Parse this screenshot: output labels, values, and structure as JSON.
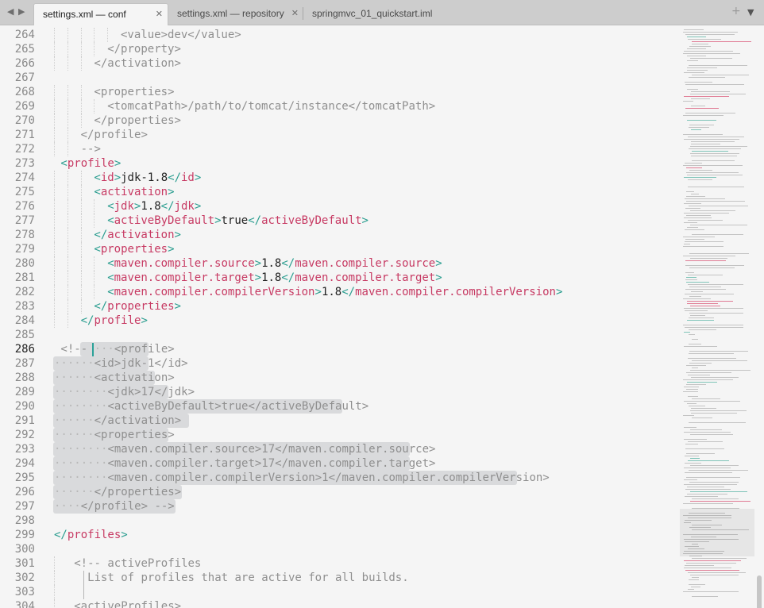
{
  "tabs": [
    {
      "label": "settings.xml — conf",
      "active": true
    },
    {
      "label": "settings.xml — repository",
      "active": false
    },
    {
      "label": "springmvc_01_quickstart.iml",
      "active": false
    }
  ],
  "icons": {
    "back": "arrow-left-icon",
    "forward": "arrow-right-icon",
    "new_tab": "plus-icon",
    "tab_menu": "chevron-down-icon",
    "close": "close-icon"
  },
  "colors": {
    "tag": "#c73a63",
    "angle": "#2a9d8f",
    "text": "#222222",
    "comment": "#8f8f8f",
    "caret": "#2aa198",
    "selection": "#d9dadc"
  },
  "editor": {
    "current_line": 286,
    "lines": [
      {
        "n": 264,
        "indent": 5,
        "tokens": [
          [
            "cm",
            "<value>dev</value>"
          ]
        ]
      },
      {
        "n": 265,
        "indent": 4,
        "tokens": [
          [
            "cm",
            "</property>"
          ]
        ]
      },
      {
        "n": 266,
        "indent": 3,
        "tokens": [
          [
            "cm",
            "</activation>"
          ]
        ]
      },
      {
        "n": 267,
        "indent": 0,
        "tokens": []
      },
      {
        "n": 268,
        "indent": 3,
        "tokens": [
          [
            "cm",
            "<properties>"
          ]
        ]
      },
      {
        "n": 269,
        "indent": 4,
        "tokens": [
          [
            "cm",
            "<tomcatPath>/path/to/tomcat/instance</tomcatPath>"
          ]
        ]
      },
      {
        "n": 270,
        "indent": 3,
        "tokens": [
          [
            "cm",
            "</properties>"
          ]
        ]
      },
      {
        "n": 271,
        "indent": 2,
        "tokens": [
          [
            "cm",
            "</profile>"
          ]
        ]
      },
      {
        "n": 272,
        "indent": 2,
        "tokens": [
          [
            "cm",
            "-->"
          ]
        ]
      },
      {
        "n": 273,
        "indent": 0,
        "shift": 1,
        "tokens": [
          [
            "at",
            "<"
          ],
          [
            "tg",
            "profile"
          ],
          [
            "at",
            ">"
          ]
        ]
      },
      {
        "n": 274,
        "indent": 3,
        "tokens": [
          [
            "at",
            "<"
          ],
          [
            "tg",
            "id"
          ],
          [
            "at",
            ">"
          ],
          [
            "tx",
            "jdk-1.8"
          ],
          [
            "at",
            "</"
          ],
          [
            "tg",
            "id"
          ],
          [
            "at",
            ">"
          ]
        ]
      },
      {
        "n": 275,
        "indent": 3,
        "tokens": [
          [
            "at",
            "<"
          ],
          [
            "tg",
            "activation"
          ],
          [
            "at",
            ">"
          ]
        ]
      },
      {
        "n": 276,
        "indent": 4,
        "tokens": [
          [
            "at",
            "<"
          ],
          [
            "tg",
            "jdk"
          ],
          [
            "at",
            ">"
          ],
          [
            "tx",
            "1.8"
          ],
          [
            "at",
            "</"
          ],
          [
            "tg",
            "jdk"
          ],
          [
            "at",
            ">"
          ]
        ]
      },
      {
        "n": 277,
        "indent": 4,
        "tokens": [
          [
            "at",
            "<"
          ],
          [
            "tg",
            "activeByDefault"
          ],
          [
            "at",
            ">"
          ],
          [
            "tx",
            "true"
          ],
          [
            "at",
            "</"
          ],
          [
            "tg",
            "activeByDefault"
          ],
          [
            "at",
            ">"
          ]
        ]
      },
      {
        "n": 278,
        "indent": 3,
        "tokens": [
          [
            "at",
            "</"
          ],
          [
            "tg",
            "activation"
          ],
          [
            "at",
            ">"
          ]
        ]
      },
      {
        "n": 279,
        "indent": 3,
        "tokens": [
          [
            "at",
            "<"
          ],
          [
            "tg",
            "properties"
          ],
          [
            "at",
            ">"
          ]
        ]
      },
      {
        "n": 280,
        "indent": 4,
        "tokens": [
          [
            "at",
            "<"
          ],
          [
            "tg",
            "maven.compiler.source"
          ],
          [
            "at",
            ">"
          ],
          [
            "tx",
            "1.8"
          ],
          [
            "at",
            "</"
          ],
          [
            "tg",
            "maven.compiler.source"
          ],
          [
            "at",
            ">"
          ]
        ]
      },
      {
        "n": 281,
        "indent": 4,
        "tokens": [
          [
            "at",
            "<"
          ],
          [
            "tg",
            "maven.compiler.target"
          ],
          [
            "at",
            ">"
          ],
          [
            "tx",
            "1.8"
          ],
          [
            "at",
            "</"
          ],
          [
            "tg",
            "maven.compiler.target"
          ],
          [
            "at",
            ">"
          ]
        ]
      },
      {
        "n": 282,
        "indent": 4,
        "tokens": [
          [
            "at",
            "<"
          ],
          [
            "tg",
            "maven.compiler.compilerVersion"
          ],
          [
            "at",
            ">"
          ],
          [
            "tx",
            "1.8"
          ],
          [
            "at",
            "</"
          ],
          [
            "tg",
            "maven.compiler.compilerVersion"
          ],
          [
            "at",
            ">"
          ]
        ]
      },
      {
        "n": 283,
        "indent": 3,
        "tokens": [
          [
            "at",
            "</"
          ],
          [
            "tg",
            "properties"
          ],
          [
            "at",
            ">"
          ]
        ]
      },
      {
        "n": 284,
        "indent": 2,
        "tokens": [
          [
            "at",
            "</"
          ],
          [
            "tg",
            "profile"
          ],
          [
            "at",
            ">"
          ]
        ]
      },
      {
        "n": 285,
        "indent": 0,
        "tokens": []
      },
      {
        "n": 286,
        "indent": 0,
        "shift": 1,
        "caret": true,
        "sel_from": 3,
        "sel_to": 13,
        "tokens": [
          [
            "cm",
            "<!-- "
          ],
          [
            "ws",
            "···"
          ],
          [
            "cm",
            "<profile>"
          ]
        ]
      },
      {
        "n": 287,
        "indent": 0,
        "sel_from": 0,
        "sel_to": 14,
        "tokens": [
          [
            "ws",
            "······"
          ],
          [
            "cm",
            "<id>jdk-1</id>"
          ]
        ]
      },
      {
        "n": 288,
        "indent": 0,
        "sel_from": 0,
        "sel_to": 15,
        "tokens": [
          [
            "ws",
            "······"
          ],
          [
            "cm",
            "<activation>"
          ]
        ]
      },
      {
        "n": 289,
        "indent": 0,
        "sel_from": 0,
        "sel_to": 17,
        "tokens": [
          [
            "ws",
            "········"
          ],
          [
            "cm",
            "<jdk>17</jdk>"
          ]
        ]
      },
      {
        "n": 290,
        "indent": 0,
        "sel_from": 0,
        "sel_to": 43,
        "tokens": [
          [
            "ws",
            "········"
          ],
          [
            "cm",
            "<activeByDefault>true</activeByDefault>"
          ]
        ]
      },
      {
        "n": 291,
        "indent": 0,
        "sel_from": 0,
        "sel_to": 20,
        "tokens": [
          [
            "ws",
            "······"
          ],
          [
            "cm",
            "</activation>"
          ]
        ]
      },
      {
        "n": 292,
        "indent": 0,
        "sel_from": 0,
        "sel_to": 17,
        "tokens": [
          [
            "ws",
            "······"
          ],
          [
            "cm",
            "<properties>"
          ]
        ]
      },
      {
        "n": 293,
        "indent": 0,
        "sel_from": 0,
        "sel_to": 53,
        "tokens": [
          [
            "ws",
            "········"
          ],
          [
            "cm",
            "<maven.compiler.source>17</maven.compiler.source>"
          ]
        ]
      },
      {
        "n": 294,
        "indent": 0,
        "sel_from": 0,
        "sel_to": 53,
        "tokens": [
          [
            "ws",
            "········"
          ],
          [
            "cm",
            "<maven.compiler.target>17</maven.compiler.target>"
          ]
        ]
      },
      {
        "n": 295,
        "indent": 0,
        "sel_from": 0,
        "sel_to": 69,
        "tokens": [
          [
            "ws",
            "········"
          ],
          [
            "cm",
            "<maven.compiler.compilerVersion>1</maven.compiler.compilerVersion>"
          ]
        ]
      },
      {
        "n": 296,
        "indent": 0,
        "sel_from": 0,
        "sel_to": 19,
        "tokens": [
          [
            "ws",
            "······"
          ],
          [
            "cm",
            "</properties>"
          ]
        ]
      },
      {
        "n": 297,
        "indent": 0,
        "sel_from": 0,
        "sel_to": 18,
        "tokens": [
          [
            "ws",
            "····"
          ],
          [
            "cm",
            "</profile>"
          ],
          [
            "cm",
            " -->"
          ]
        ]
      },
      {
        "n": 298,
        "indent": 0,
        "tokens": []
      },
      {
        "n": 299,
        "indent": 0,
        "tokens": [
          [
            "at",
            "</"
          ],
          [
            "tg",
            "profiles"
          ],
          [
            "at",
            ">"
          ]
        ]
      },
      {
        "n": 300,
        "indent": 0,
        "tokens": []
      },
      {
        "n": 301,
        "indent": 1,
        "shift": 1,
        "tokens": [
          [
            "cm",
            "<!-- activeProfiles"
          ]
        ]
      },
      {
        "n": 302,
        "indent": 1,
        "shift": 1,
        "pipe": true,
        "tokens": [
          [
            "cm",
            "  List of profiles that are active for all builds."
          ]
        ]
      },
      {
        "n": 303,
        "indent": 1,
        "shift": 1,
        "pipe": true,
        "tokens": []
      },
      {
        "n": 304,
        "indent": 1,
        "shift": 1,
        "tokens": [
          [
            "cm",
            "<activeProfiles>"
          ]
        ]
      }
    ]
  }
}
